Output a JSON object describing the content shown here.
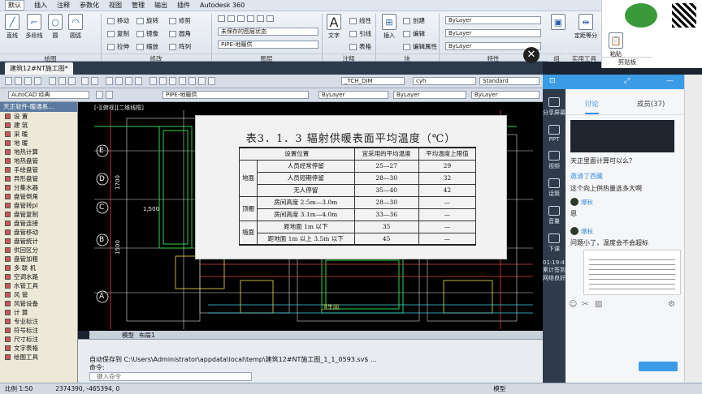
{
  "menubar": [
    "默认",
    "插入",
    "注释",
    "参数化",
    "视图",
    "管理",
    "输出",
    "插件",
    "Autodesk 360"
  ],
  "ribbon": {
    "draw_tools": [
      "直线",
      "多段线",
      "圆",
      "圆弧"
    ],
    "modify_tools": [
      "移动",
      "旋转",
      "修剪",
      "复制",
      "镜像",
      "圆角",
      "拉伸",
      "缩放",
      "阵列"
    ],
    "layer_state": "未保存的图层状态",
    "layer_current": "PIPE-地暖供",
    "annotation": [
      "文字",
      "线性",
      "引线",
      "表格"
    ],
    "block": [
      "插入",
      "创建",
      "编辑",
      "编辑属性"
    ],
    "properties": [
      "ByLayer",
      "ByLayer",
      "ByLayer"
    ],
    "utilities": [
      "定距等分"
    ],
    "clipboard": [
      "粘贴"
    ],
    "group_labels": [
      "绘图",
      "修改",
      "图层",
      "注释",
      "块",
      "特性",
      "组",
      "实用工具",
      "剪贴板"
    ]
  },
  "file_tab": "建筑12#NT施工图*",
  "toolbar_combos": {
    "workspace": "AutoCAD 经典",
    "dim_style": "_TCH_DIM",
    "text_style": "cyh",
    "table_style": "Standard",
    "layer": "PIPE-地暖供",
    "color": "ByLayer",
    "linetype": "ByLayer",
    "lineweight": "ByLayer"
  },
  "left_panel": {
    "title": "天正软件-暖通系...",
    "items": [
      "设 置",
      "建 筑",
      "采 暖",
      "地 暖",
      "地热计算",
      "地热盘管",
      "手绘盘管",
      "异形盘管",
      "分集水器",
      "盘管倒角",
      "盘管转pl",
      "盘管复制",
      "盘管连接",
      "盘管移动",
      "盘管统计",
      "供回区分",
      "盘管加粗",
      "多 联 机",
      "空调水路",
      "水管工具",
      "风 管",
      "风管设备",
      "计 算",
      "专业标注",
      "符号标注",
      "尺寸标注",
      "文字表格",
      "绘图工具"
    ]
  },
  "canvas": {
    "view_label": "[-][俯视][二维线框]",
    "axis_labels": [
      "E",
      "D",
      "C",
      "B",
      "A"
    ],
    "dims": [
      "1700",
      "1500",
      "1,500"
    ],
    "room_label": "卫生间"
  },
  "model_tabs": [
    "模型",
    "布局1"
  ],
  "command": {
    "line1": "自动保存到 C:\\Users\\Administrator\\appdata\\local\\temp\\建筑12#NT施工图_1_1_0593.sv$ ...",
    "line2": "命令:",
    "placeholder": "键入命令"
  },
  "status": {
    "scale": "比例 1:50",
    "coords": "2374390, -465394, 0",
    "model": "模型"
  },
  "popup": {
    "title": "表3．1．3 辐射供暖表面平均温度（℃）",
    "headers": [
      "设置位置",
      "宜采用的平均温度",
      "平均温度上限值"
    ],
    "rows": [
      {
        "group": "地面",
        "label": "人员经常停留",
        "avg": "25—27",
        "max": "29"
      },
      {
        "group": "",
        "label": "人员短期停留",
        "avg": "28—30",
        "max": "32"
      },
      {
        "group": "",
        "label": "无人停留",
        "avg": "35—40",
        "max": "42"
      },
      {
        "group": "顶棚",
        "label": "房间高度 2.5m—3.0m",
        "avg": "28—30",
        "max": "—"
      },
      {
        "group": "",
        "label": "房间高度 3.1m—4.0m",
        "avg": "33—36",
        "max": "—"
      },
      {
        "group": "墙面",
        "label": "距地面 1m 以下",
        "avg": "35",
        "max": "—"
      },
      {
        "group": "",
        "label": "距地面 1m 以上 3.5m 以下",
        "avg": "45",
        "max": "—"
      }
    ]
  },
  "chat": {
    "side_items": [
      "分享屏幕",
      "PPT",
      "视频",
      "话筒",
      "音量",
      "下课"
    ],
    "timer": "01:19:47",
    "timer_sub": "累计签到",
    "net": "网络良好",
    "tabs": [
      "讨论",
      "成员(37)"
    ],
    "messages": [
      {
        "text": "天正里面计算可以么？"
      },
      {
        "text": "邀请了西藏",
        "link": true
      },
      {
        "text": "这个向上供热量选多大啊"
      },
      {
        "name": "爆秋",
        "text": "恩"
      },
      {
        "name": "爆秋",
        "text": "问题小了，温度会不会超标"
      }
    ]
  },
  "colors": {
    "chat_blue": "#3c9be7",
    "canvas_bg": "#000000",
    "ribbon_bg": "#e6ebf1"
  }
}
